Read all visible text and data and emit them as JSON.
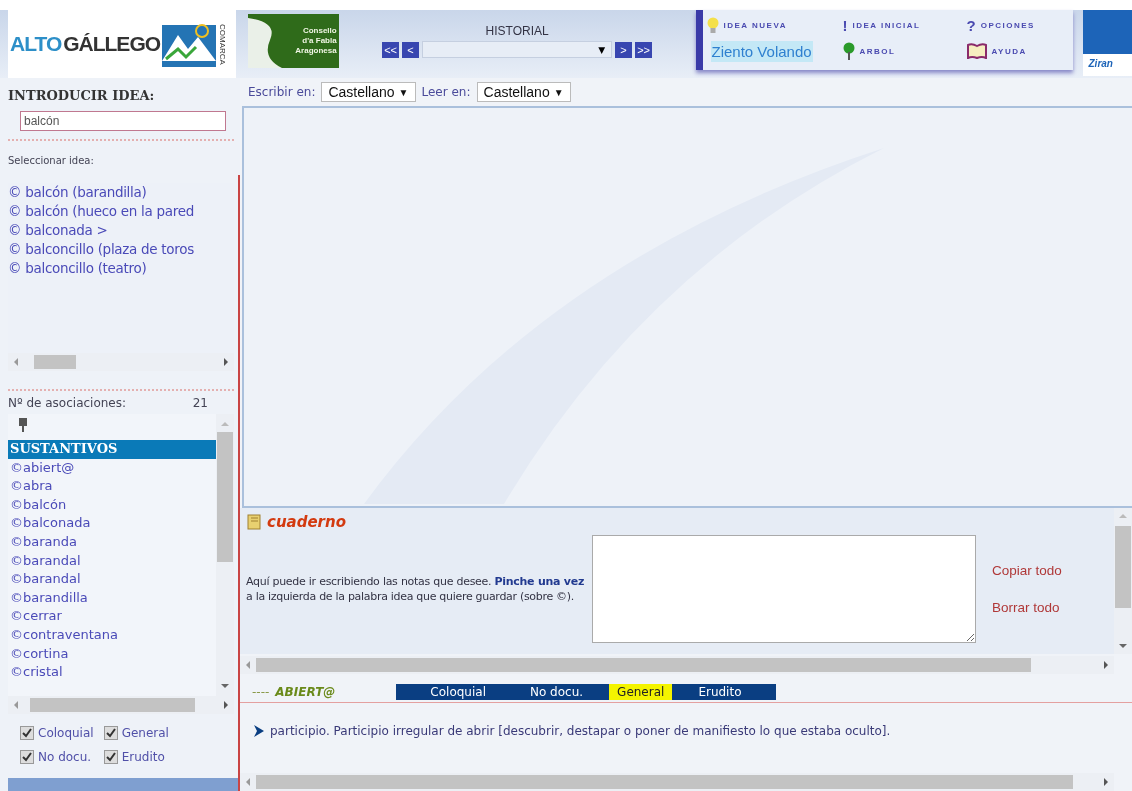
{
  "header": {
    "logo_left": {
      "word_a": "ALTO",
      "word_b": "GÁLLEGO",
      "vertical": "COMARCA"
    },
    "logo_green": {
      "lines": [
        "Consello",
        "d'a Fabla",
        "Aragonesa"
      ]
    },
    "history": {
      "title": "HISTORIAL",
      "buttons_left": [
        "<<",
        "<"
      ],
      "dropdown_arrow": "▼",
      "buttons_right": [
        ">",
        ">>"
      ]
    },
    "menu": [
      {
        "kind": "bulb",
        "label": "IDEA NUEVA"
      },
      {
        "kind": "glyph",
        "icon_text": "!",
        "label": "IDEA INICIAL"
      },
      {
        "kind": "glyph",
        "icon_text": "?",
        "label": "OPCIONES"
      },
      {
        "kind": "link",
        "label": "Ziento Volando"
      },
      {
        "kind": "tree",
        "label": "ARBOL"
      },
      {
        "kind": "book",
        "label": "AYUDA"
      }
    ],
    "logo_right": {
      "text": "Ziran"
    }
  },
  "sidebar": {
    "title": "INTRODUCIR IDEA:",
    "search_value": "balcón",
    "select_label": "Seleccionar idea:",
    "ideas": [
      {
        "label": "© balcón (barandilla)"
      },
      {
        "label": "© balcón (hueco en la pared"
      },
      {
        "label": "© balconada >"
      },
      {
        "label": "© balconcillo (plaza de toros"
      },
      {
        "label": "© balconcillo (teatro)"
      }
    ],
    "assoc_label": "Nº de asociaciones:",
    "assoc_count": "21",
    "associations": [
      {
        "label": "SUSTANTIVOS",
        "selected": true
      },
      {
        "label": "©abiert@",
        "selected": false
      },
      {
        "label": "©abra",
        "selected": false
      },
      {
        "label": "©balcón",
        "selected": false
      },
      {
        "label": "©balconada",
        "selected": false
      },
      {
        "label": "©baranda",
        "selected": false
      },
      {
        "label": "©barandal",
        "selected": false
      },
      {
        "label": "©barandal",
        "selected": false
      },
      {
        "label": "©barandilla",
        "selected": false
      },
      {
        "label": "©cerrar",
        "selected": false
      },
      {
        "label": "©contraventana",
        "selected": false
      },
      {
        "label": "©cortina",
        "selected": false
      },
      {
        "label": "©cristal",
        "selected": false
      }
    ],
    "filters": [
      {
        "label": "Coloquial",
        "checked": true
      },
      {
        "label": "General",
        "checked": true
      },
      {
        "label": "No docu.",
        "checked": true
      },
      {
        "label": "Erudito",
        "checked": true
      }
    ]
  },
  "main": {
    "write_label": "Escribir en:",
    "write_value": "Castellano",
    "read_label": "Leer en:",
    "read_value": "Castellano",
    "select_arrow": "▼",
    "notebook": {
      "title": "cuaderno",
      "text": "Aquí puede ir escribiendo las notas que desee. **Pinche una vez** a la izquierda de la palabra idea que quiere guardar (sobre ©).",
      "links": [
        "Copiar todo",
        "Borrar todo"
      ]
    },
    "entry": {
      "dashes": "----",
      "word": "ABIERT@",
      "registers": [
        {
          "label": "Coloquial",
          "selected": false
        },
        {
          "label": "No docu.",
          "selected": false
        },
        {
          "label": "General",
          "selected": true
        },
        {
          "label": "Erudito",
          "selected": false
        }
      ],
      "definition": "participio. Participio irregular de abrir [descubrir, destapar o poner de manifiesto lo que estaba oculto]."
    }
  }
}
